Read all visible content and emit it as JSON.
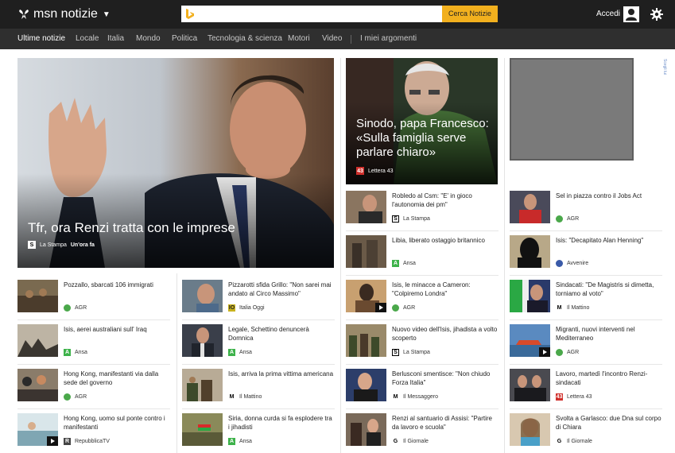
{
  "header": {
    "brand": "msn notizie",
    "search_placeholder": "",
    "search_button": "Cerca Notizie",
    "signin": "Accedi"
  },
  "nav": [
    {
      "label": "Ultime notizie"
    },
    {
      "label": "Locale"
    },
    {
      "label": "Italia"
    },
    {
      "label": "Mondo"
    },
    {
      "label": "Politica"
    },
    {
      "label": "Tecnologia & scienza"
    },
    {
      "label": "Motori"
    },
    {
      "label": "Video"
    },
    {
      "label": "I miei argomenti"
    }
  ],
  "hero": {
    "title": "Tfr, ora Renzi tratta con le imprese",
    "source": "La Stampa",
    "time": "Un'ora fa"
  },
  "hero2": {
    "title": "Sinodo, papa Francesco: «Sulla famiglia serve parlare chiaro»",
    "source": "Lettera 43"
  },
  "ad": {
    "label": "Scegli lui"
  },
  "col1": [
    {
      "headline": "Pozzallo, sbarcati 106 immigrati",
      "source": "AGR"
    },
    {
      "headline": "Isis, aerei australiani sull' Iraq",
      "source": "Ansa"
    },
    {
      "headline": "Hong Kong, manifestanti via dalla sede del governo",
      "source": "AGR"
    },
    {
      "headline": "Hong Kong, uomo sul ponte contro i manifestanti",
      "source": "RepubblicaTV"
    }
  ],
  "col2": [
    {
      "headline": "Pizzarotti sfida Grillo: \"Non sarei mai andato al Circo Massimo\"",
      "source": "Italia Oggi"
    },
    {
      "headline": "Legale, Schettino denuncerà Domnica",
      "source": "Ansa"
    },
    {
      "headline": "Isis, arriva la prima vittima americana",
      "source": "Il Mattino"
    },
    {
      "headline": "Siria, donna curda si fa esplodere tra i jihadisti",
      "source": "Ansa"
    }
  ],
  "col3": [
    {
      "headline": "Robledo al Csm: \"E' in gioco l'autonomia dei pm\"",
      "source": "La Stampa"
    },
    {
      "headline": "Libia, liberato ostaggio britannico",
      "source": "Ansa"
    },
    {
      "headline": "Isis, le minacce a Cameron: \"Colpiremo Londra\"",
      "source": "AGR"
    },
    {
      "headline": "Nuovo video dell'Isis, jihadista a volto scoperto",
      "source": "La Stampa"
    },
    {
      "headline": "Berlusconi smentisce: \"Non chiudo Forza Italia\"",
      "source": "Il Messaggero"
    },
    {
      "headline": "Renzi al santuario di Assisi: \"Partire da lavoro e scuola\"",
      "source": "Il Giornale"
    }
  ],
  "col4": [
    {
      "headline": "Sel in piazza contro il Jobs Act",
      "source": "AGR"
    },
    {
      "headline": "Isis: \"Decapitato Alan Henning\"",
      "source": "Avvenire"
    },
    {
      "headline": "Sindacati: \"De Magistris si dimetta, torniamo al voto\"",
      "source": "Il Mattino"
    },
    {
      "headline": "Migranti, nuovi interventi nel Mediterraneo",
      "source": "AGR"
    },
    {
      "headline": "Lavoro, martedì l'incontro Renzi-sindacati",
      "source": "Lettera 43"
    },
    {
      "headline": "Svolta a Garlasco: due Dna sul corpo di Chiara",
      "source": "Il Giornale"
    }
  ]
}
